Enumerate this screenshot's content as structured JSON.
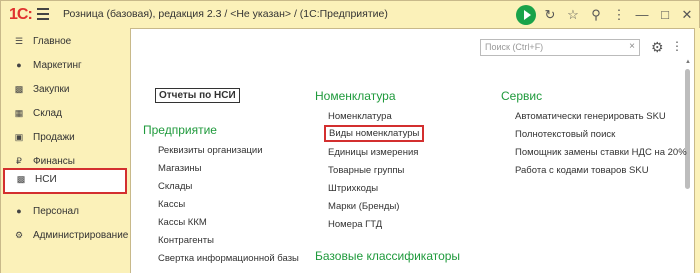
{
  "titlebar": {
    "logo": "1С:",
    "title": "Розница (базовая), редакция 2.3 / <Не указан> / (1С:Предприятие)"
  },
  "sidebar": {
    "items": [
      {
        "label": "Главное",
        "icon": "menu-icon"
      },
      {
        "label": "Маркетинг",
        "icon": "marketing-icon"
      },
      {
        "label": "Закупки",
        "icon": "cart-icon"
      },
      {
        "label": "Склад",
        "icon": "warehouse-icon"
      },
      {
        "label": "Продажи",
        "icon": "sales-icon"
      },
      {
        "label": "Финансы",
        "icon": "finance-icon"
      },
      {
        "label": "НСИ",
        "icon": "nsi-icon",
        "active": true
      },
      {
        "label": "Персонал",
        "icon": "person-icon"
      },
      {
        "label": "Администрирование",
        "icon": "gear-icon"
      }
    ]
  },
  "search": {
    "placeholder": "Поиск (Ctrl+F)",
    "clear": "×"
  },
  "main": {
    "reports_link": "Отчеты по НСИ",
    "enterprise": {
      "title": "Предприятие",
      "links": [
        "Реквизиты организации",
        "Магазины",
        "Склады",
        "Кассы",
        "Кассы ККМ",
        "Контрагенты",
        "Свертка информационной базы"
      ]
    },
    "nomenclature": {
      "title": "Номенклатура",
      "links": [
        "Номенклатура",
        "Виды номенклатуры",
        "Единицы измерения",
        "Товарные группы",
        "Штрихкоды",
        "Марки (Бренды)",
        "Номера ГТД"
      ]
    },
    "base_classifiers": {
      "title": "Базовые классификаторы"
    },
    "service": {
      "title": "Сервис",
      "links": [
        "Автоматически генерировать SKU",
        "Полнотекстовый поиск",
        "Помощник замены ставки НДС на 20%",
        "Работа с кодами товаров SKU"
      ]
    }
  },
  "colors": {
    "accent_green": "#1f9a3c",
    "highlight_red": "#d32f2f",
    "panel_yellow": "#fbf1b9"
  }
}
